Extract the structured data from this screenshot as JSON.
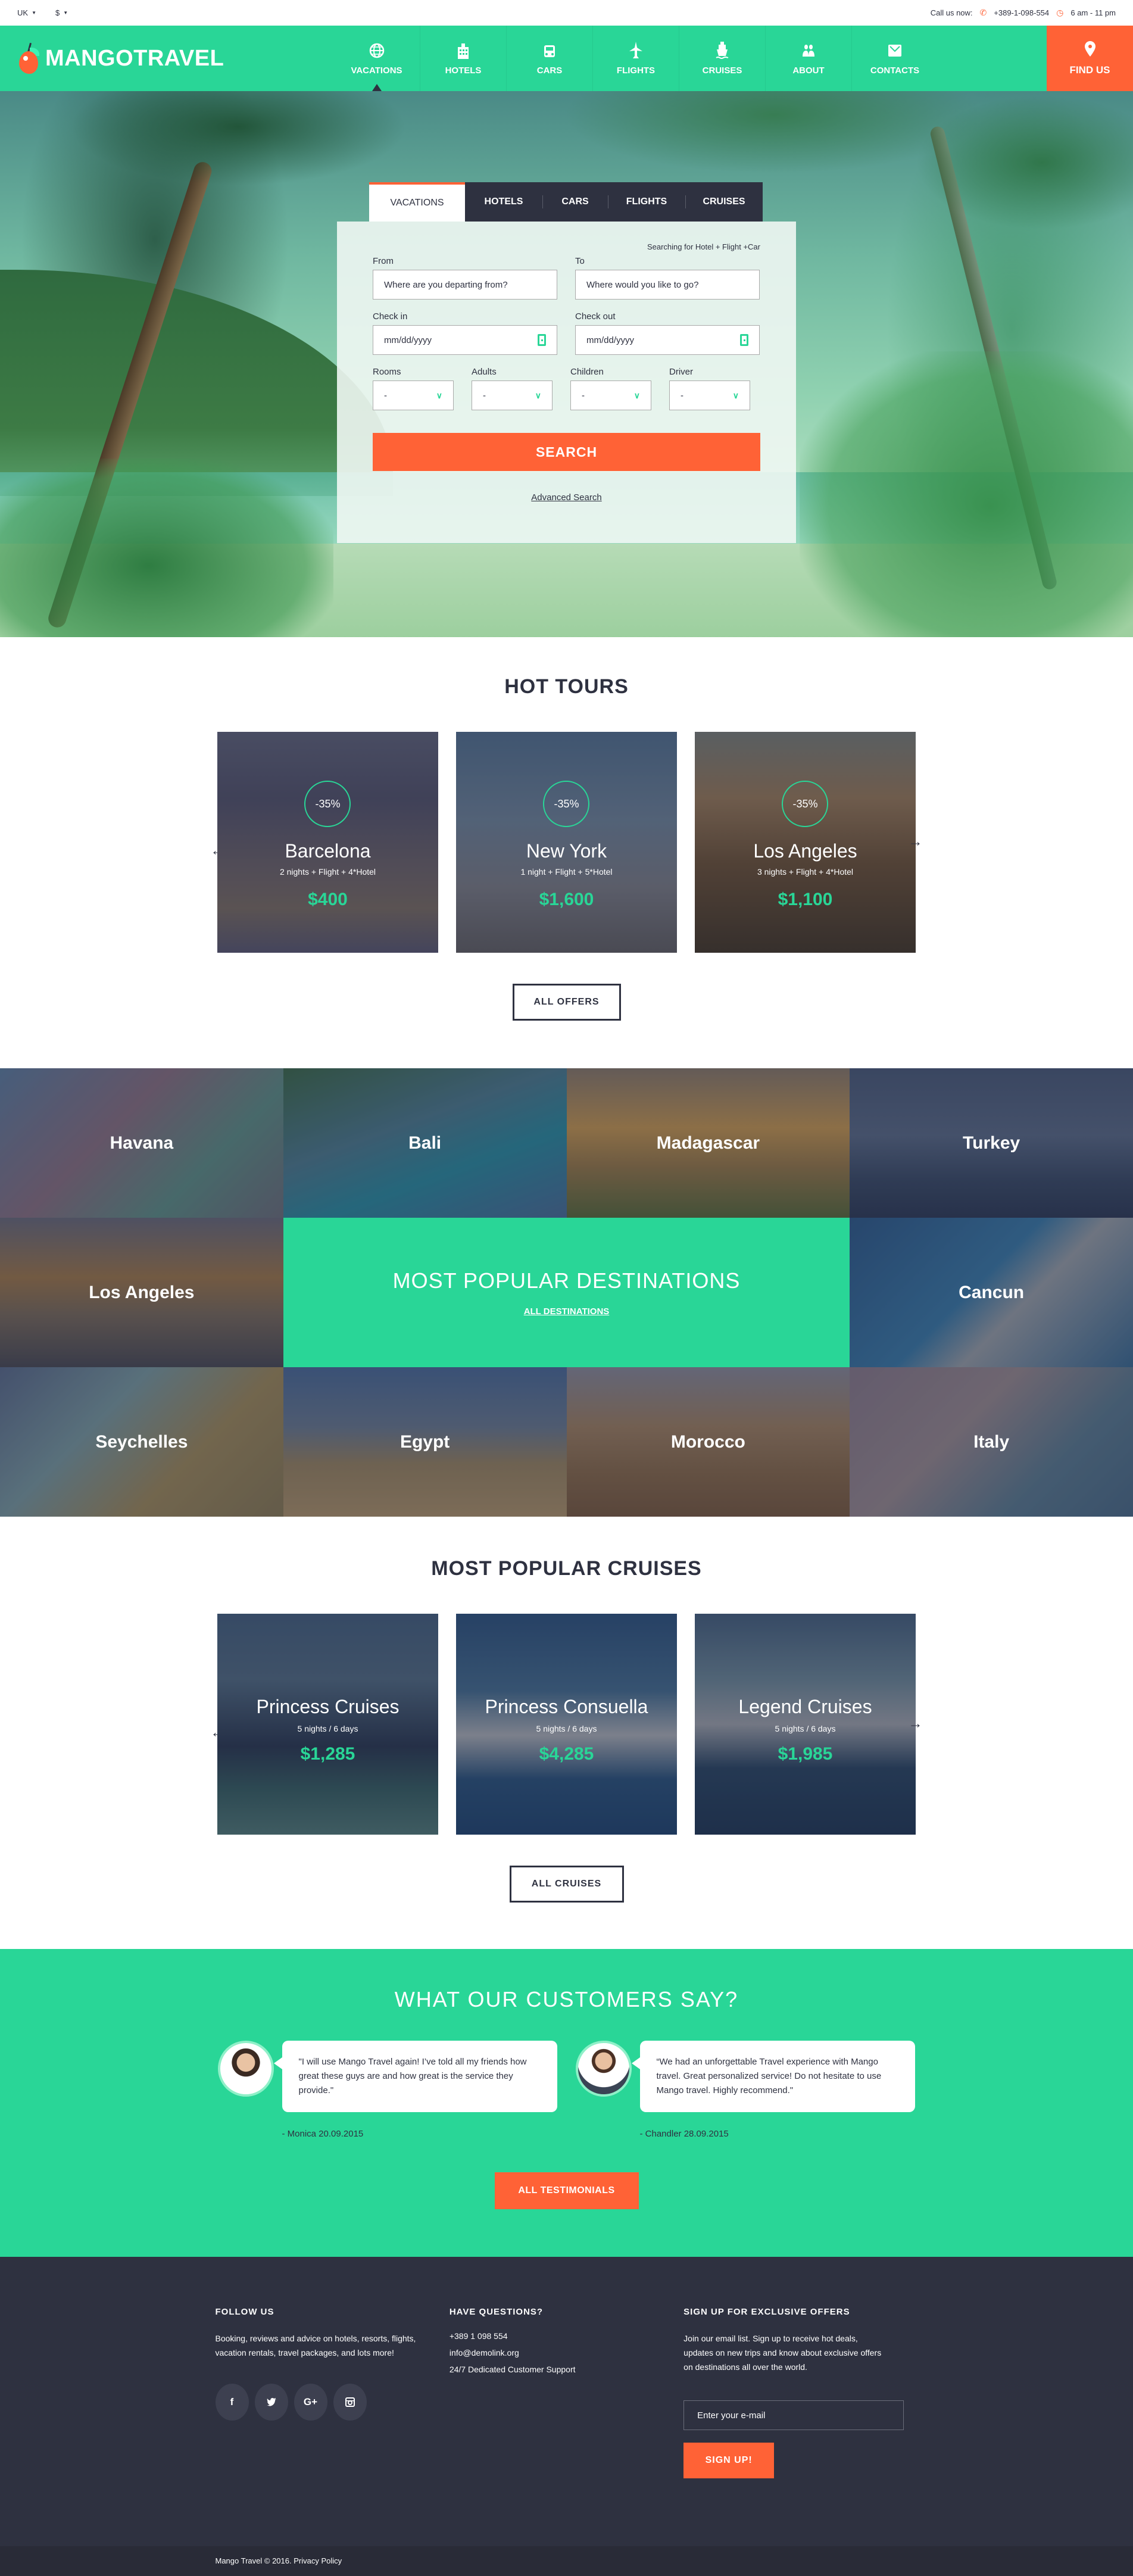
{
  "topbar": {
    "language": "UK",
    "currency": "$",
    "call_label": "Call us now:",
    "phone": "+389-1-098-554",
    "hours": "6 am - 11 pm"
  },
  "header": {
    "logo_text": "MANGOTRAVEL",
    "nav": [
      {
        "label": "VACATIONS",
        "icon": "globe-icon",
        "active": true
      },
      {
        "label": "HOTELS",
        "icon": "building-icon",
        "active": false
      },
      {
        "label": "CARS",
        "icon": "car-icon",
        "active": false
      },
      {
        "label": "FLIGHTS",
        "icon": "plane-icon",
        "active": false
      },
      {
        "label": "CRUISES",
        "icon": "ship-icon",
        "active": false
      },
      {
        "label": "ABOUT",
        "icon": "people-icon",
        "active": false
      },
      {
        "label": "CONTACTS",
        "icon": "mail-icon",
        "active": false
      }
    ],
    "find_us": "FIND US"
  },
  "search": {
    "tabs": [
      "VACATIONS",
      "HOTELS",
      "CARS",
      "FLIGHTS",
      "CRUISES"
    ],
    "active_tab": "VACATIONS",
    "hint": "Searching for Hotel + Flight +Car",
    "from_label": "From",
    "from_placeholder": "Where are you departing from?",
    "to_label": "To",
    "to_placeholder": "Where would you like to go?",
    "checkin_label": "Check in",
    "checkin_placeholder": "mm/dd/yyyy",
    "checkout_label": "Check out",
    "checkout_placeholder": "mm/dd/yyyy",
    "selects": [
      {
        "label": "Rooms",
        "value": "-"
      },
      {
        "label": "Adults",
        "value": "-"
      },
      {
        "label": "Children",
        "value": "-"
      },
      {
        "label": "Driver",
        "value": "-"
      }
    ],
    "button": "SEARCH",
    "advanced": "Advanced Search"
  },
  "hot_tours": {
    "title": "HOT TOURS",
    "items": [
      {
        "city": "Barcelona",
        "discount": "-35%",
        "details": "2 nights + Flight + 4*Hotel",
        "price": "$400"
      },
      {
        "city": "New York",
        "discount": "-35%",
        "details": "1 night + Flight + 5*Hotel",
        "price": "$1,600"
      },
      {
        "city": "Los Angeles",
        "discount": "-35%",
        "details": "3 nights + Flight + 4*Hotel",
        "price": "$1,100"
      }
    ],
    "button": "ALL OFFERS"
  },
  "destinations": {
    "title": "MOST POPULAR DESTINATIONS",
    "link": "ALL DESTINATIONS",
    "tiles": [
      "Havana",
      "Bali",
      "Madagascar",
      "Turkey",
      "Los Angeles",
      "Cancun",
      "Seychelles",
      "Egypt",
      "Morocco",
      "Italy"
    ]
  },
  "cruises": {
    "title": "MOST POPULAR CRUISES",
    "items": [
      {
        "name": "Princess Cruises",
        "details": "5 nights / 6 days",
        "price": "$1,285"
      },
      {
        "name": "Princess Consuella",
        "details": "5 nights / 6 days",
        "price": "$4,285"
      },
      {
        "name": "Legend Cruises",
        "details": "5 nights / 6 days",
        "price": "$1,985"
      }
    ],
    "button": "ALL CRUISES"
  },
  "testimonials": {
    "title": "WHAT OUR CUSTOMERS SAY?",
    "items": [
      {
        "quote": "\"I will use Mango Travel again! I’ve told all my friends how great these guys are and how great is the service they provide.\"",
        "author": "- Monica  20.09.2015"
      },
      {
        "quote": "“We had an unforgettable Travel experience with Mango travel. Great personalized service! Do not hesitate to use Mango travel. Highly recommend.\"",
        "author": "- Chandler  28.09.2015"
      }
    ],
    "button": "ALL TESTIMONIALS"
  },
  "footer": {
    "follow_title": "FOLLOW US",
    "follow_text": "Booking, reviews and advice on hotels, resorts, flights, vacation rentals, travel packages, and lots more!",
    "social": [
      "f",
      "t",
      "G+",
      "ig"
    ],
    "questions_title": "HAVE QUESTIONS?",
    "phone": "+389 1 098 554",
    "email": "info@demolink.org",
    "support": "24/7 Dedicated Customer Support",
    "signup_title": "SIGN UP FOR EXCLUSIVE OFFERS",
    "signup_text": "Join our email list. Sign up to receive hot deals, updates on new trips and know about exclusive offers on destinations all over the world.",
    "email_placeholder": "Enter your e-mail",
    "signup_button": "SIGN UP!",
    "copyright": "Mango Travel © 2016.",
    "privacy": "Privacy Policy"
  },
  "colors": {
    "accent_green": "#29d697",
    "accent_orange": "#ff6236",
    "dark": "#2e3140"
  }
}
